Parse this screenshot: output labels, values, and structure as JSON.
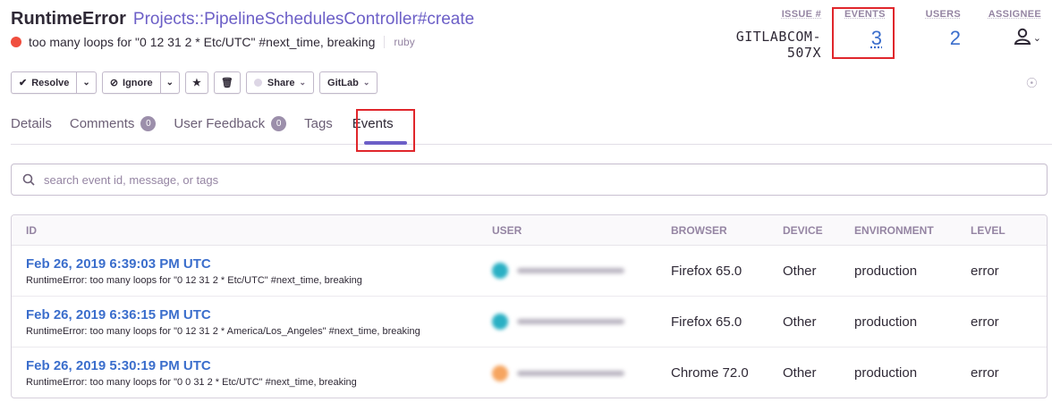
{
  "issue": {
    "type": "RuntimeError",
    "culprit": "Projects::PipelineSchedulesController#create",
    "message": "too many loops for \"0 12 31 2 * Etc/UTC\" #next_time, breaking",
    "platform": "ruby"
  },
  "stats": {
    "issue_label": "ISSUE #",
    "issue_value": "GITLABCOM-507X",
    "events_label": "EVENTS",
    "events_value": "3",
    "users_label": "USERS",
    "users_value": "2",
    "assignee_label": "ASSIGNEE"
  },
  "toolbar": {
    "resolve": "Resolve",
    "ignore": "Ignore",
    "share": "Share",
    "gitlab": "GitLab"
  },
  "tabs": {
    "details": "Details",
    "comments": "Comments",
    "comments_count": "0",
    "user_feedback": "User Feedback",
    "user_feedback_count": "0",
    "tags": "Tags",
    "events": "Events"
  },
  "search": {
    "placeholder": "search event id, message, or tags"
  },
  "table": {
    "headers": {
      "id": "ID",
      "user": "USER",
      "browser": "BROWSER",
      "device": "DEVICE",
      "environment": "ENVIRONMENT",
      "level": "LEVEL"
    },
    "rows": [
      {
        "date": "Feb 26, 2019 6:39:03 PM UTC",
        "message": "RuntimeError: too many loops for \"0 12 31 2 * Etc/UTC\" #next_time, breaking",
        "avatar_color": "#2ab0c4",
        "browser": "Firefox 65.0",
        "device": "Other",
        "environment": "production",
        "level": "error"
      },
      {
        "date": "Feb 26, 2019 6:36:15 PM UTC",
        "message": "RuntimeError: too many loops for \"0 12 31 2 * America/Los_Angeles\" #next_time, breaking",
        "avatar_color": "#2ab0c4",
        "browser": "Firefox 65.0",
        "device": "Other",
        "environment": "production",
        "level": "error"
      },
      {
        "date": "Feb 26, 2019 5:30:19 PM UTC",
        "message": "RuntimeError: too many loops for \"0 0 31 2 * Etc/UTC\" #next_time, breaking",
        "avatar_color": "#f6a560",
        "browser": "Chrome 72.0",
        "device": "Other",
        "environment": "production",
        "level": "error"
      }
    ]
  },
  "colors": {
    "accent_purple": "#6c5fc7",
    "link_blue": "#3b6ecc",
    "error_red": "#f04e3e",
    "highlight_box": "#e0262b"
  }
}
